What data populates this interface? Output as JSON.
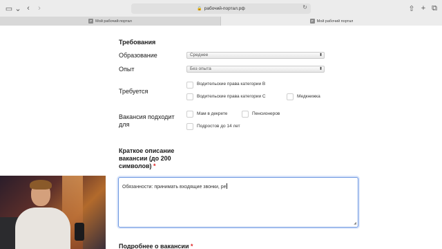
{
  "browser": {
    "address": "рабочий-портал.рф",
    "tabs": [
      {
        "label": "Мой рабочий портал",
        "favicon": "Р"
      },
      {
        "label": "Мой рабочий портал",
        "favicon": "Р"
      }
    ]
  },
  "form": {
    "section_title": "Требования",
    "education": {
      "label": "Образование",
      "value": "Среднее"
    },
    "experience": {
      "label": "Опыт",
      "value": "Без опыта"
    },
    "required": {
      "label": "Требуется",
      "options": [
        "Водительские права категории B",
        "Водительские права категории C",
        "Медкнижка"
      ]
    },
    "suitable_for": {
      "label_line1": "Вакансия подходит",
      "label_line2": "для",
      "options": [
        "Мам в декрете",
        "Пенсионеров",
        "Подростов до 14 лет"
      ]
    },
    "short_description": {
      "label_line1": "Краткое описание",
      "label_line2": "вакансии (до 200",
      "label_line3": "символов)",
      "required_mark": "*",
      "value": "Обязанности: принимать входящие звонки, ре"
    },
    "more_about": {
      "label": "Подробнее о вакансии",
      "required_mark": "*"
    }
  }
}
